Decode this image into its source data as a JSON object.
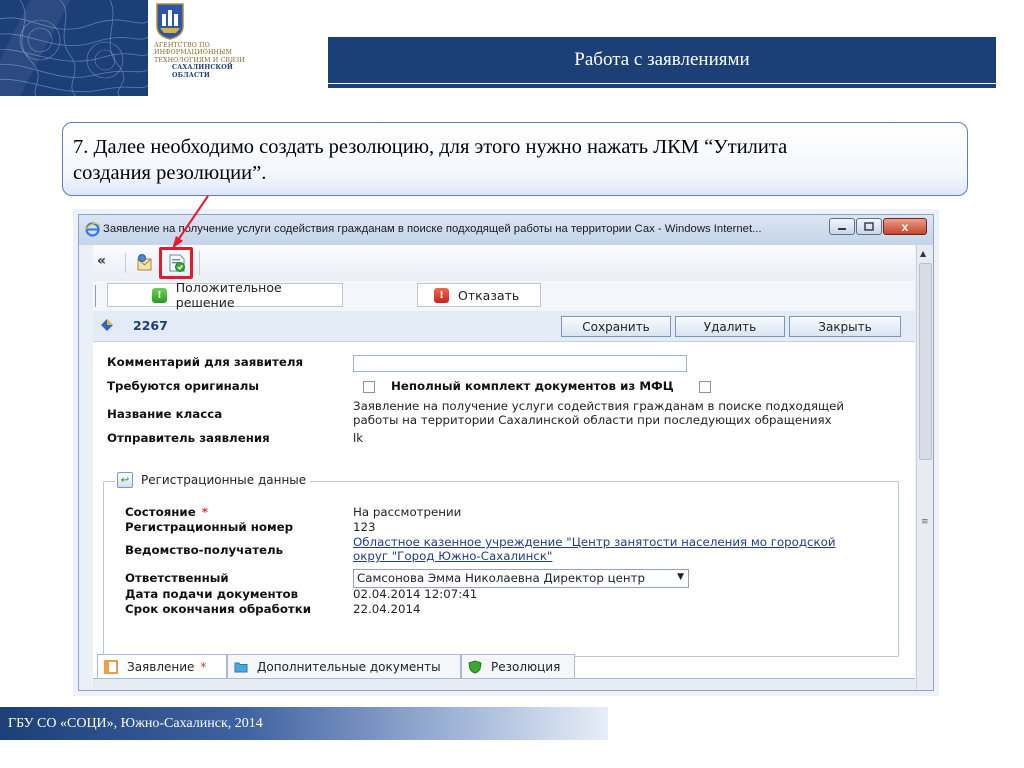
{
  "slide": {
    "title": "Работа с заявлениями",
    "agency_line1": "АГЕНТСТВО ПО",
    "agency_line2": "ИНФОРМАЦИОННЫМ",
    "agency_line3": "ТЕХНОЛОГИЯМ И СВЯЗИ",
    "agency_line4": "САХАЛИНСКОЙ",
    "agency_line5": "ОБЛАСТИ",
    "instruction_line1": "7. Далее необходимо создать резолюцию, для этого нужно нажать ЛКМ “Утилита",
    "instruction_line2": "создания резолюции”.",
    "footer": "ГБУ СО «СОЦИ», Южно-Сахалинск, 2014",
    "brand_color": "#1d3f78",
    "highlight_color": "#e41b2c"
  },
  "window": {
    "title": "Заявление на получение услуги содействия гражданам в поиске подходящей работы на территории Сах - Windows Internet...",
    "minimize_icon": "minimize-icon",
    "maximize_icon": "maximize-icon",
    "close_label": "x"
  },
  "toolbar": {
    "collapse_label": "«",
    "icons": [
      "send-icon",
      "create-resolution-icon"
    ]
  },
  "decisions": {
    "positive_icon": "!",
    "positive_label": "Положительное решение",
    "negative_icon": "!",
    "negative_label": "Отказать"
  },
  "record": {
    "id": "2267",
    "save_label": "Сохранить",
    "delete_label": "Удалить",
    "close_label": "Закрыть"
  },
  "form": {
    "comment_label": "Комментарий для заявителя",
    "comment_value": "",
    "originals_label": "Требуются оригиналы",
    "incomplete_label": "Неполный комплект документов из МФЦ",
    "class_label": "Название класса",
    "class_value_line1": "Заявление на получение услуги содействия гражданам в поиске подходящей",
    "class_value_line2": "работы на территории Сахалинской области при последующих обращениях",
    "sender_label": "Отправитель заявления",
    "sender_value": "lk"
  },
  "registration": {
    "legend": "Регистрационные данные",
    "legend_icon": "↩",
    "state_label": "Состояние",
    "required_mark": "*",
    "state_value": "На рассмотрении",
    "regnum_label": "Регистрационный номер",
    "regnum_value": "123",
    "agency_label": "Ведомство-получатель",
    "agency_value_line1": "Областное казенное учреждение \"Центр занятости населения мо городской",
    "agency_value_line2": "округ \"Город Южно-Сахалинск\"",
    "responsible_label": "Ответственный",
    "responsible_value": "Самсонова Эмма Николаевна Директор центр",
    "submit_date_label": "Дата подачи документов",
    "submit_date_value": "02.04.2014 12:07:41",
    "deadline_label": "Срок окончания обработки",
    "deadline_value": "22.04.2014"
  },
  "tabs": [
    {
      "label": "Заявление",
      "required": "*"
    },
    {
      "label": "Дополнительные документы"
    },
    {
      "label": "Резолюция"
    }
  ]
}
